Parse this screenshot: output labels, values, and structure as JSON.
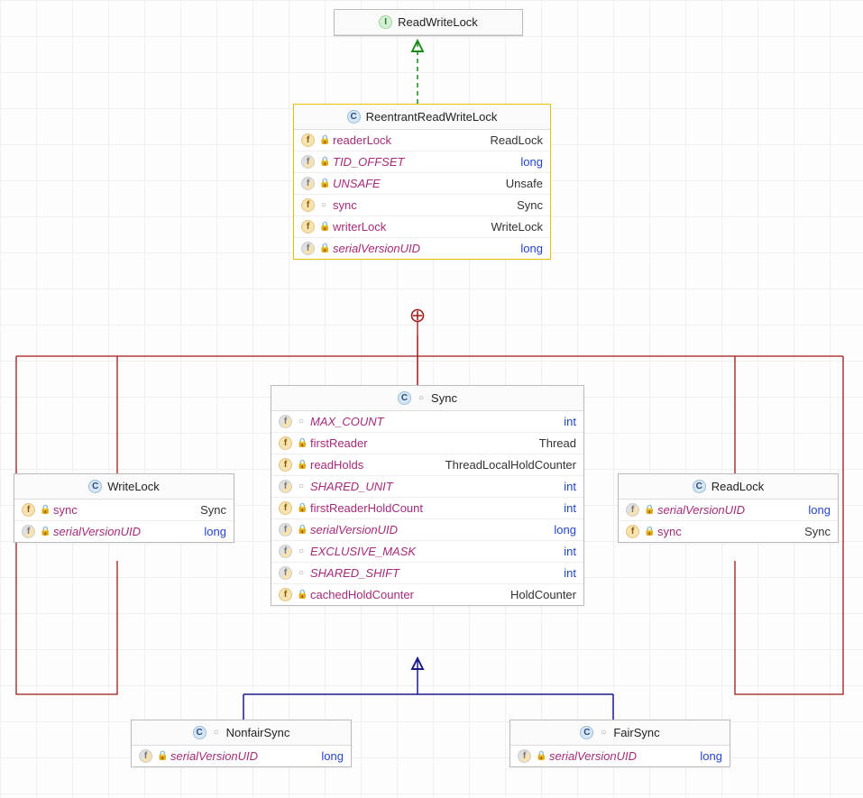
{
  "classes": {
    "ReadWriteLock": {
      "name": "ReadWriteLock",
      "stereotype": "interface"
    },
    "ReentrantReadWriteLock": {
      "name": "ReentrantReadWriteLock",
      "stereotype": "class",
      "fields": [
        {
          "name": "readerLock",
          "type": "ReadLock",
          "italic": false,
          "typeColor": "normal",
          "icon": "f",
          "vis": "private"
        },
        {
          "name": "TID_OFFSET",
          "type": "long",
          "italic": true,
          "typeColor": "blue",
          "icon": "fs",
          "vis": "private"
        },
        {
          "name": "UNSAFE",
          "type": "Unsafe",
          "italic": true,
          "typeColor": "normal",
          "icon": "fs",
          "vis": "private"
        },
        {
          "name": "sync",
          "type": "Sync",
          "italic": false,
          "typeColor": "normal",
          "icon": "f",
          "vis": "package"
        },
        {
          "name": "writerLock",
          "type": "WriteLock",
          "italic": false,
          "typeColor": "normal",
          "icon": "f",
          "vis": "private"
        },
        {
          "name": "serialVersionUID",
          "type": "long",
          "italic": true,
          "typeColor": "blue",
          "icon": "fs",
          "vis": "private"
        }
      ]
    },
    "WriteLock": {
      "name": "WriteLock",
      "stereotype": "class",
      "fields": [
        {
          "name": "sync",
          "type": "Sync",
          "italic": false,
          "typeColor": "normal",
          "icon": "f",
          "vis": "private"
        },
        {
          "name": "serialVersionUID",
          "type": "long",
          "italic": true,
          "typeColor": "blue",
          "icon": "fs",
          "vis": "private"
        }
      ]
    },
    "ReadLock": {
      "name": "ReadLock",
      "stereotype": "class",
      "fields": [
        {
          "name": "serialVersionUID",
          "type": "long",
          "italic": true,
          "typeColor": "blue",
          "icon": "fs",
          "vis": "private"
        },
        {
          "name": "sync",
          "type": "Sync",
          "italic": false,
          "typeColor": "normal",
          "icon": "f",
          "vis": "private"
        }
      ]
    },
    "Sync": {
      "name": "Sync",
      "stereotype": "class",
      "fields": [
        {
          "name": "MAX_COUNT",
          "type": "int",
          "italic": true,
          "typeColor": "blue",
          "icon": "fs",
          "vis": "package"
        },
        {
          "name": "firstReader",
          "type": "Thread",
          "italic": false,
          "typeColor": "normal",
          "icon": "f",
          "vis": "private"
        },
        {
          "name": "readHolds",
          "type": "ThreadLocalHoldCounter",
          "italic": false,
          "typeColor": "normal",
          "icon": "f",
          "vis": "private"
        },
        {
          "name": "SHARED_UNIT",
          "type": "int",
          "italic": true,
          "typeColor": "blue",
          "icon": "fs",
          "vis": "package"
        },
        {
          "name": "firstReaderHoldCount",
          "type": "int",
          "italic": false,
          "typeColor": "blue",
          "icon": "f",
          "vis": "private"
        },
        {
          "name": "serialVersionUID",
          "type": "long",
          "italic": true,
          "typeColor": "blue",
          "icon": "fs",
          "vis": "private"
        },
        {
          "name": "EXCLUSIVE_MASK",
          "type": "int",
          "italic": true,
          "typeColor": "blue",
          "icon": "fs",
          "vis": "package"
        },
        {
          "name": "SHARED_SHIFT",
          "type": "int",
          "italic": true,
          "typeColor": "blue",
          "icon": "fs",
          "vis": "package"
        },
        {
          "name": "cachedHoldCounter",
          "type": "HoldCounter",
          "italic": false,
          "typeColor": "normal",
          "icon": "f",
          "vis": "private"
        }
      ]
    },
    "NonfairSync": {
      "name": "NonfairSync",
      "stereotype": "class",
      "fields": [
        {
          "name": "serialVersionUID",
          "type": "long",
          "italic": true,
          "typeColor": "blue",
          "icon": "fs",
          "vis": "private"
        }
      ]
    },
    "FairSync": {
      "name": "FairSync",
      "stereotype": "class",
      "fields": [
        {
          "name": "serialVersionUID",
          "type": "long",
          "italic": true,
          "typeColor": "blue",
          "icon": "fs",
          "vis": "private"
        }
      ]
    }
  },
  "relations": [
    {
      "from": "ReentrantReadWriteLock",
      "to": "ReadWriteLock",
      "kind": "realization"
    },
    {
      "from": "WriteLock",
      "to": "ReentrantReadWriteLock",
      "kind": "inner"
    },
    {
      "from": "ReadLock",
      "to": "ReentrantReadWriteLock",
      "kind": "inner"
    },
    {
      "from": "Sync",
      "to": "ReentrantReadWriteLock",
      "kind": "inner"
    },
    {
      "from": "NonfairSync",
      "to": "ReentrantReadWriteLock",
      "kind": "inner"
    },
    {
      "from": "FairSync",
      "to": "ReentrantReadWriteLock",
      "kind": "inner"
    },
    {
      "from": "NonfairSync",
      "to": "Sync",
      "kind": "generalization"
    },
    {
      "from": "FairSync",
      "to": "Sync",
      "kind": "generalization"
    }
  ]
}
